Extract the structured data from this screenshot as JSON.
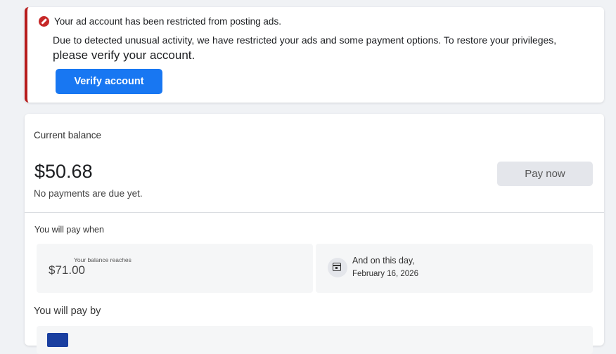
{
  "alert": {
    "title": "Your ad account has been restricted from posting ads.",
    "body": "Due to detected unusual activity, we have restricted your ads and some payment options. To restore your privileges,",
    "emphasis": "please verify your account.",
    "button_label": "Verify account",
    "icon": "restricted-icon",
    "accent_color": "#b71c1c"
  },
  "balance": {
    "label": "Current balance",
    "amount": "$50.68",
    "subtext": "No payments are due yet.",
    "pay_button_label": "Pay now"
  },
  "pay_when": {
    "heading": "You will pay when",
    "threshold": {
      "label": "Your balance reaches",
      "value": "$71.00"
    },
    "date": {
      "label": "And on this day,",
      "value": "February 16, 2026",
      "icon": "calendar-icon"
    }
  },
  "pay_by": {
    "heading": "You will pay by",
    "card_icon": "credit-card-icon"
  },
  "colors": {
    "primary_button": "#1877f2",
    "alert_red": "#c62828",
    "background": "#f0f2f5"
  }
}
